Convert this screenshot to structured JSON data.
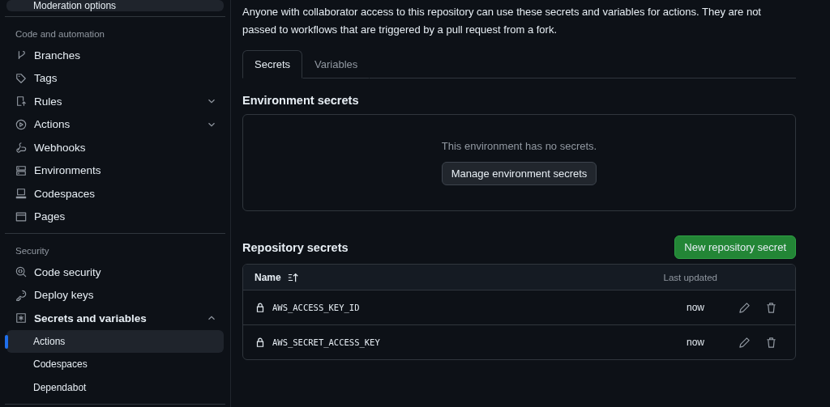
{
  "sidebar": {
    "top_item": {
      "label": "Moderation options",
      "hovered": true
    },
    "sections": [
      {
        "heading": "Code and automation",
        "items": [
          {
            "label": "Branches",
            "current": false
          },
          {
            "label": "Tags",
            "current": false
          },
          {
            "label": "Rules",
            "current": false,
            "expanded": false
          },
          {
            "label": "Actions",
            "current": false,
            "expanded": false
          },
          {
            "label": "Webhooks",
            "current": false
          },
          {
            "label": "Environments",
            "current": false
          },
          {
            "label": "Codespaces",
            "current": false
          },
          {
            "label": "Pages",
            "current": false
          }
        ]
      },
      {
        "heading": "Security",
        "items": [
          {
            "label": "Code security",
            "current": false
          },
          {
            "label": "Deploy keys",
            "current": false
          },
          {
            "label": "Secrets and variables",
            "current": true,
            "expanded": true,
            "children": [
              {
                "label": "Actions",
                "selected": true
              },
              {
                "label": "Codespaces",
                "selected": false
              },
              {
                "label": "Dependabot",
                "selected": false
              }
            ]
          }
        ]
      }
    ]
  },
  "intro": "Anyone with collaborator access to this repository can use these secrets and variables for actions. They are not passed to workflows that are triggered by a pull request from a fork.",
  "tabs": [
    {
      "label": "Secrets",
      "selected": true
    },
    {
      "label": "Variables",
      "selected": false
    }
  ],
  "environment_secrets": {
    "title": "Environment secrets",
    "empty_text": "This environment has no secrets.",
    "button": "Manage environment secrets"
  },
  "repository_secrets": {
    "title": "Repository secrets",
    "button": "New repository secret",
    "columns": [
      "Name",
      "Last updated"
    ],
    "rows": [
      {
        "name": "AWS_ACCESS_KEY_ID",
        "updated": "now"
      },
      {
        "name": "AWS_SECRET_ACCESS_KEY",
        "updated": "now"
      }
    ]
  }
}
